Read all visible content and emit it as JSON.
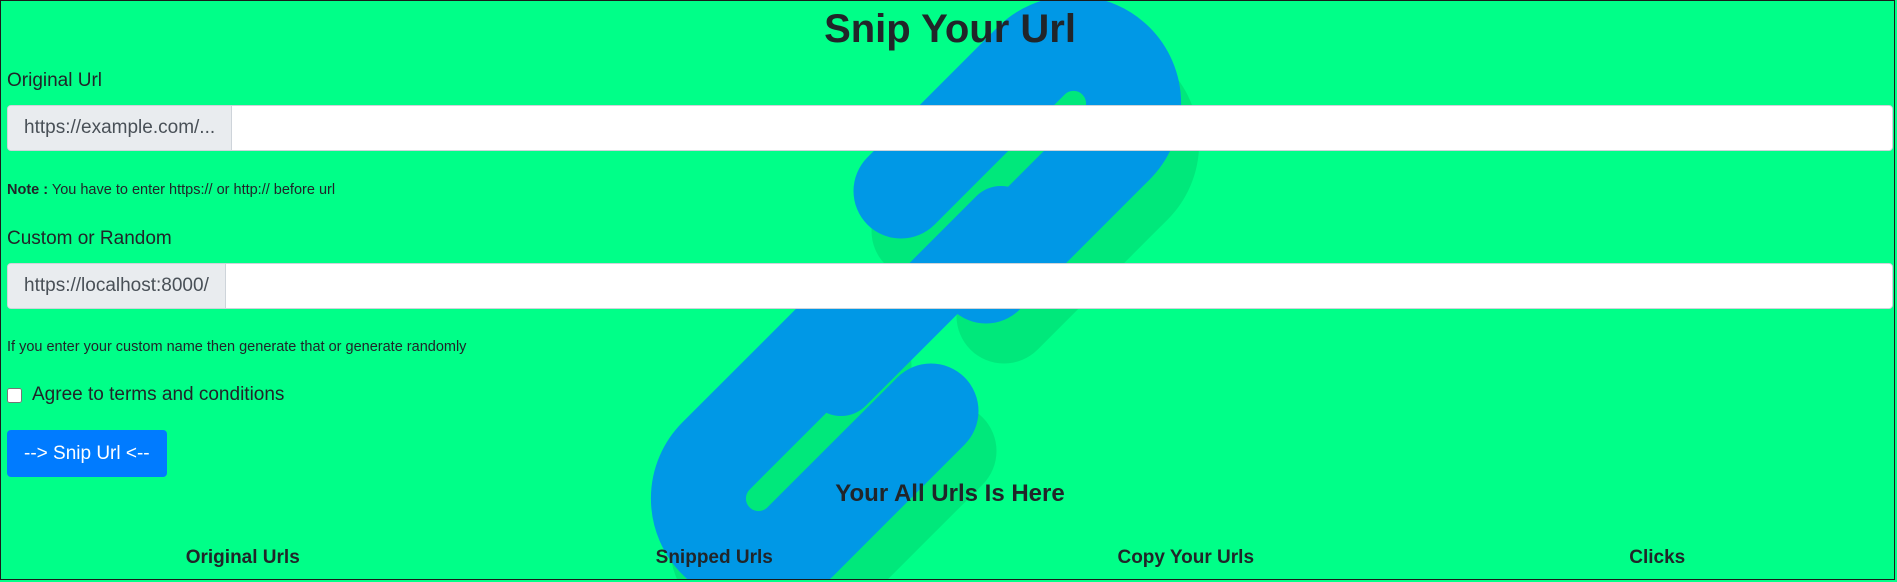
{
  "page": {
    "title": "Snip Your Url",
    "background_color": "#00ff88",
    "logo_icon": "link-chain-icon"
  },
  "form": {
    "original_url": {
      "label": "Original Url",
      "prefix": "https://example.com/...",
      "value": ""
    },
    "note": {
      "bold": "Note :",
      "text": " You have to enter https:// or http:// before url"
    },
    "custom": {
      "label": "Custom or Random",
      "prefix": "https://localhost:8000/",
      "value": ""
    },
    "custom_help": "If you enter your custom name then generate that or generate randomly",
    "terms": {
      "label": "Agree to terms and conditions",
      "checked": false
    },
    "submit_label": "--> Snip Url <--",
    "button_color": "#007bff"
  },
  "urls_section": {
    "title": "Your All Urls Is Here",
    "columns": [
      "Original Urls",
      "Snipped Urls",
      "Copy Your Urls",
      "Clicks"
    ]
  }
}
